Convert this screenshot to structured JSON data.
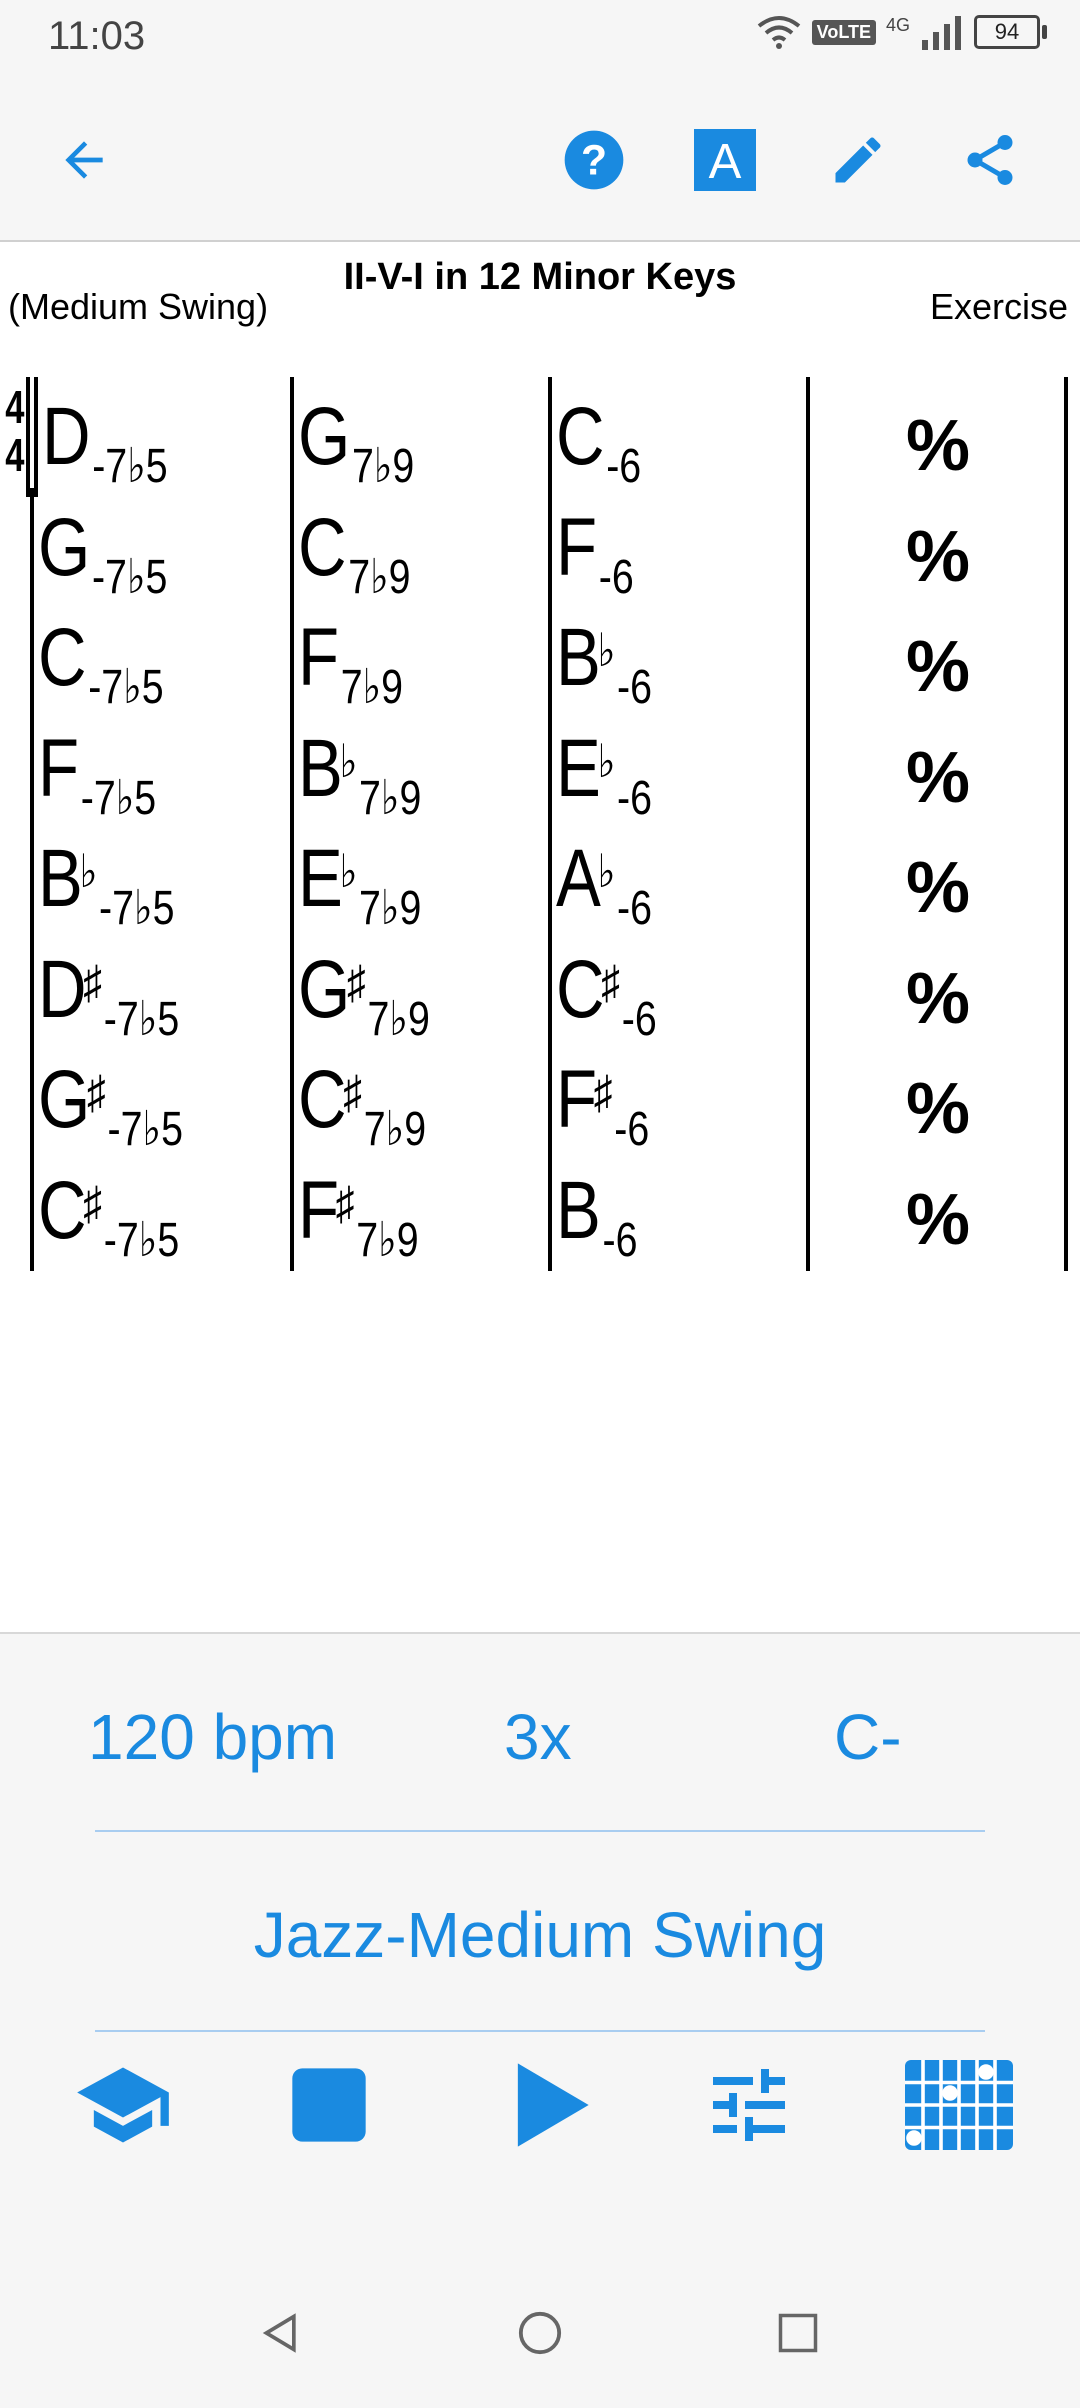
{
  "status": {
    "time": "11:03",
    "volte": "VoLTE",
    "network": "4G",
    "battery": "94"
  },
  "toolbar": {
    "icons": [
      "back-arrow-icon",
      "help-icon",
      "font-icon",
      "edit-pencil-icon",
      "share-icon"
    ],
    "accent": "#1a8ae0"
  },
  "sheet": {
    "title": "II-V-I in 12 Minor Keys",
    "style": "(Medium Swing)",
    "composer": "Exercise",
    "time_signature": {
      "top": "4",
      "bottom": "4"
    },
    "rows": [
      [
        {
          "root": "D",
          "acc": "",
          "ext": "-7♭5"
        },
        {
          "root": "G",
          "acc": "",
          "ext": "7♭9"
        },
        {
          "root": "C",
          "acc": "",
          "ext": "-6"
        }
      ],
      [
        {
          "root": "G",
          "acc": "",
          "ext": "-7♭5"
        },
        {
          "root": "C",
          "acc": "",
          "ext": "7♭9"
        },
        {
          "root": "F",
          "acc": "",
          "ext": "-6"
        }
      ],
      [
        {
          "root": "C",
          "acc": "",
          "ext": "-7♭5"
        },
        {
          "root": "F",
          "acc": "",
          "ext": "7♭9"
        },
        {
          "root": "B",
          "acc": "♭",
          "ext": "-6"
        }
      ],
      [
        {
          "root": "F",
          "acc": "",
          "ext": "-7♭5"
        },
        {
          "root": "B",
          "acc": "♭",
          "ext": "7♭9"
        },
        {
          "root": "E",
          "acc": "♭",
          "ext": "-6"
        }
      ],
      [
        {
          "root": "B",
          "acc": "♭",
          "ext": "-7♭5"
        },
        {
          "root": "E",
          "acc": "♭",
          "ext": "7♭9"
        },
        {
          "root": "A",
          "acc": "♭",
          "ext": "-6"
        }
      ],
      [
        {
          "root": "D",
          "acc": "♯",
          "ext": "-7♭5"
        },
        {
          "root": "G",
          "acc": "♯",
          "ext": "7♭9"
        },
        {
          "root": "C",
          "acc": "♯",
          "ext": "-6"
        }
      ],
      [
        {
          "root": "G",
          "acc": "♯",
          "ext": "-7♭5"
        },
        {
          "root": "C",
          "acc": "♯",
          "ext": "7♭9"
        },
        {
          "root": "F",
          "acc": "♯",
          "ext": "-6"
        }
      ],
      [
        {
          "root": "C",
          "acc": "♯",
          "ext": "-7♭5"
        },
        {
          "root": "F",
          "acc": "♯",
          "ext": "7♭9"
        },
        {
          "root": "B",
          "acc": "",
          "ext": "-6"
        }
      ]
    ],
    "repeat_symbol": "%"
  },
  "controls": {
    "tempo": "120 bpm",
    "repeats": "3x",
    "key": "C-",
    "style": "Jazz-Medium Swing",
    "buttons": [
      "graduation-cap-icon",
      "stop-icon",
      "play-icon",
      "mixer-sliders-icon",
      "fretboard-icon"
    ]
  },
  "navbar": {
    "buttons": [
      "nav-back-icon",
      "nav-home-icon",
      "nav-recents-icon"
    ]
  }
}
